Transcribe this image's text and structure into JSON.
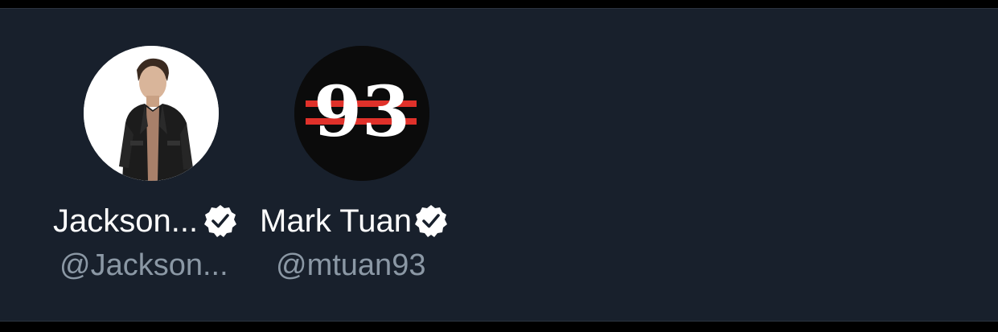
{
  "accounts": [
    {
      "display_name": "Jackson...",
      "handle": "@Jackson...",
      "verified": true,
      "avatar_icon": "person-photo-avatar"
    },
    {
      "display_name": "Mark Tuan",
      "handle": "@mtuan93",
      "verified": true,
      "avatar_icon": "93-logo-avatar",
      "avatar_text": "93"
    }
  ],
  "colors": {
    "background": "#18202c",
    "name_text": "#ffffff",
    "handle_text": "#8b98a5",
    "badge": "#ffffff",
    "logo_stripe": "#e0312a"
  }
}
